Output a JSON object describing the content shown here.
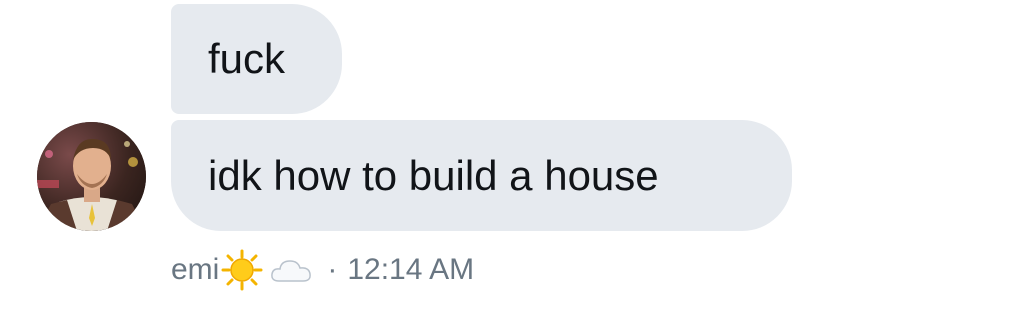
{
  "messages": [
    {
      "text": "fuck"
    },
    {
      "text": "idk how to build a house"
    }
  ],
  "meta": {
    "sender": "emi",
    "status_icons": [
      "sun-icon",
      "cloud-icon"
    ],
    "separator": "·",
    "time": "12:14 AM"
  },
  "colors": {
    "bubble_bg": "#e6eaef",
    "text": "#111418",
    "meta_text": "#697682"
  }
}
